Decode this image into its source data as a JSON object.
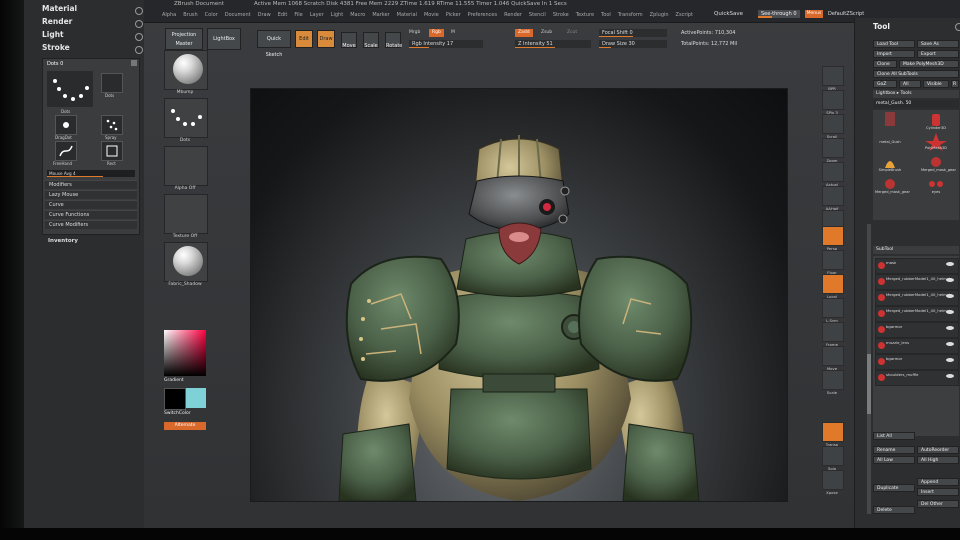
{
  "menubar": {
    "doc_title": "ZBrush Document",
    "info": "Active Mem 1068  Scratch Disk 4381  Free Mem 2229  ZTime 1.619  RTime 11.555  Timer 1.046  QuickSave In 1 Secs",
    "menus": [
      "Alpha",
      "Brush",
      "Color",
      "Document",
      "Draw",
      "Edit",
      "File",
      "Layer",
      "Light",
      "Macro",
      "Marker",
      "Material",
      "Movie",
      "Picker",
      "Preferences",
      "Render",
      "Stencil",
      "Stroke",
      "Texture",
      "Tool",
      "Transform",
      "Zplugin",
      "Zscript"
    ],
    "quicksave": "QuickSave",
    "seethrough": "See-through 0",
    "menus_btn": "Menus",
    "default_script": "DefaultZScript"
  },
  "left_tray": {
    "top_items": [
      "Material",
      "Render",
      "Light",
      "Stroke"
    ],
    "brush_panel": {
      "header": "Dots 0",
      "icons": [
        "Dots",
        "Dots",
        "DragDot",
        "Spray",
        "FreeHand",
        "Rect"
      ],
      "slider": "Mouse Avg 4",
      "menus": [
        "Modifiers",
        "Lazy Mouse",
        "Curve",
        "Curve Functions",
        "Curve Modifiers"
      ]
    },
    "inventory": "Inventory"
  },
  "shelf": {
    "projection_master": "Projection Master",
    "lightbox": "LightBox",
    "quick_sketch": "Quick Sketch",
    "edit": "Edit",
    "draw": "Draw",
    "move": "Move",
    "scale": "Scale",
    "rotate": "Rotate",
    "mrgb": "Mrgb",
    "rgb": "Rgb",
    "m": "M",
    "rgb_intensity": "Rgb Intensity 17",
    "zadd": "Zadd",
    "zsub": "Zsub",
    "zcut": "Zcut",
    "z_intensity": "Z Intensity 51",
    "focal_shift": "Focal Shift 0",
    "draw_size": "Draw Size 30",
    "active_points": "ActivePoints: 710,304",
    "total_points": "TotalPoints: 12,772 Mil"
  },
  "left_shelf": {
    "thumbs": [
      "Mbump",
      "Dots",
      "Alpha Off",
      "Texture Off",
      "Fabric_Shadow"
    ],
    "gradient": "Gradient",
    "switch_color": "SwitchColor",
    "alternate": "Alternate"
  },
  "right_strip": {
    "items": [
      "BPR",
      "SPix 3",
      "Scroll",
      "Zoom",
      "Actual",
      "AAHalf",
      "Dynamic",
      "Persp",
      "Floor",
      "Local",
      "L.Sym",
      "Frame",
      "Move",
      "Scale",
      "Rotate",
      "Line Fill",
      "Transp",
      "Dynamic",
      "Solo",
      "Xpose"
    ]
  },
  "tool_panel": {
    "title": "Tool",
    "buttons": [
      "Load Tool",
      "Save As",
      "Import",
      "Export",
      "Clone",
      "Make PolyMesh3D",
      "Clone All SubTools",
      "GoZ",
      "All",
      "Visible",
      "R"
    ],
    "lightbox_tools": "Lightbox ▸ Tools",
    "current_tool": "metal_Gush. 50",
    "tools": [
      "metal_Gush",
      "Cylinder3D",
      "PolyMesh3D",
      "SimpleBrush",
      "Merged_mask_gear",
      "Merged_mask_gear",
      "eyes"
    ],
    "subtool_header": "SubTool",
    "subtools": [
      "mask",
      "Merged_rubberModel1_40_helmet",
      "Merged_rubberModel1_40_helmet",
      "Merged_rubberModel1_40_helmet",
      "bgarmor",
      "muzzle_lens",
      "bgarmor",
      "shoulders_muffle"
    ],
    "list_all": "List All",
    "rename": "Rename",
    "autoreorder": "AutoReorder",
    "all_low": "All Low",
    "all_high": "All High",
    "duplicate": "Duplicate",
    "append": "Append",
    "insert": "Insert",
    "delete": "Delete",
    "del_other": "Del Other"
  },
  "colors": {
    "accent": "#e07a2a",
    "panel": "#2c2e30",
    "canvas": "#3d4043",
    "armor_green": "#4f6a52",
    "armor_tan": "#a79a72"
  }
}
